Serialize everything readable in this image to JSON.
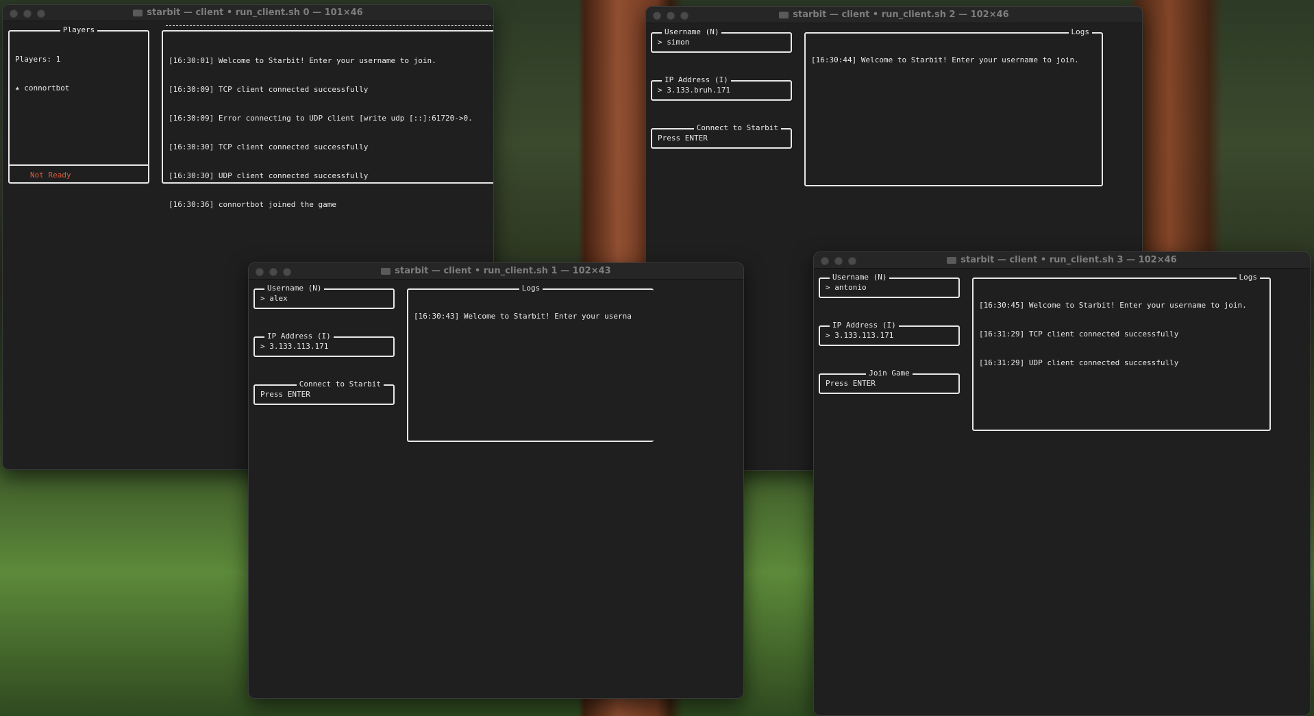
{
  "colors": {
    "terminal_bg": "#1f1f1f",
    "text": "#e8e8e8",
    "status_not_ready": "#e05a3c"
  },
  "windows": [
    {
      "title": "starbit — client • run_client.sh 0 — 101×46",
      "players_box": {
        "title": "Players",
        "count_line": "Players: 1",
        "players": [
          "★ connortbot"
        ],
        "status": "Not Ready"
      },
      "logs": [
        "[16:30:01] Welcome to Starbit! Enter your username to join.",
        "[16:30:09] TCP client connected successfully",
        "[16:30:09] Error connecting to UDP client [write udp [::]:61720->0.",
        "[16:30:30] TCP client connected successfully",
        "[16:30:30] UDP client connected successfully",
        "[16:30:36] connortbot joined the game"
      ]
    },
    {
      "title": "starbit — client • run_client.sh 1 — 102×43",
      "username": {
        "title": "Username (N)",
        "value": "> alex"
      },
      "ip": {
        "title": "IP Address (I)",
        "value": "> 3.133.113.171"
      },
      "action": {
        "title": "Connect to Starbit",
        "value": "Press ENTER"
      },
      "logs_title": "Logs",
      "logs": [
        "[16:30:43] Welcome to Starbit! Enter your userna"
      ]
    },
    {
      "title": "starbit — client • run_client.sh 2 — 102×46",
      "username": {
        "title": "Username (N)",
        "value": "> simon"
      },
      "ip": {
        "title": "IP Address (I)",
        "value": "> 3.133.bruh.171"
      },
      "action": {
        "title": "Connect to Starbit",
        "value": "Press ENTER"
      },
      "logs_title": "Logs",
      "logs": [
        "[16:30:44] Welcome to Starbit! Enter your username to join."
      ]
    },
    {
      "title": "starbit — client • run_client.sh 3 — 102×46",
      "username": {
        "title": "Username (N)",
        "value": "> antonio"
      },
      "ip": {
        "title": "IP Address (I)",
        "value": "> 3.133.113.171"
      },
      "action": {
        "title": "Join Game",
        "value": "Press ENTER"
      },
      "logs_title": "Logs",
      "logs": [
        "[16:30:45] Welcome to Starbit! Enter your username to join.",
        "[16:31:29] TCP client connected successfully",
        "[16:31:29] UDP client connected successfully"
      ]
    }
  ]
}
